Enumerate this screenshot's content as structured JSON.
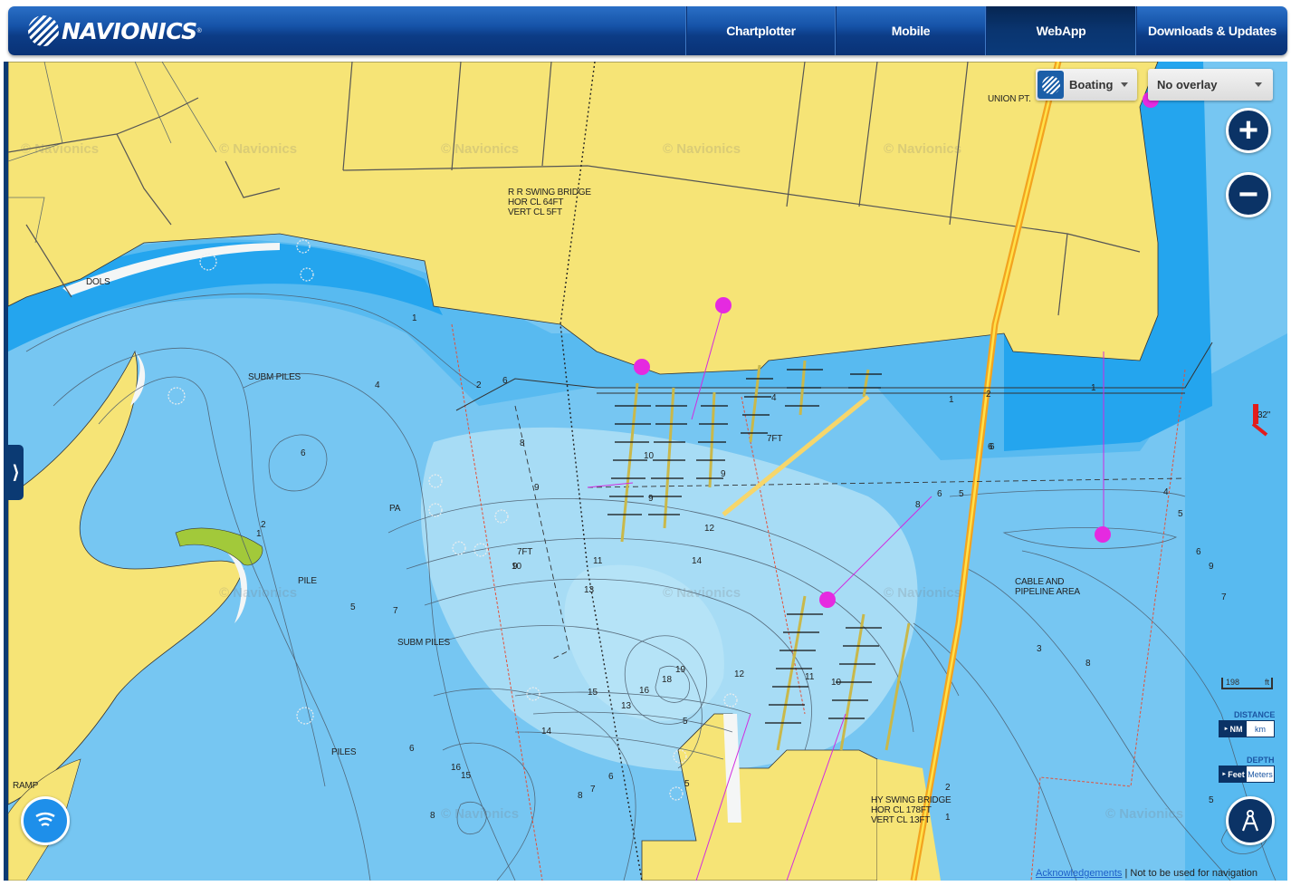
{
  "header": {
    "logo_text": "NAVIONICS",
    "logo_reg": "®",
    "nav": [
      {
        "label": "Chartplotter",
        "active": false
      },
      {
        "label": "Mobile",
        "active": false
      },
      {
        "label": "WebApp",
        "active": true
      },
      {
        "label": "Downloads & Updates",
        "active": false
      }
    ]
  },
  "map": {
    "chart_mode": {
      "selected": "Boating",
      "icon": "navionics-boating-icon"
    },
    "overlay": {
      "selected": "No overlay"
    },
    "zoom_in_label": "+",
    "zoom_out_label": "−",
    "side_toggle": "⟩",
    "scale": {
      "value": "198",
      "unit": "ft"
    },
    "distance": {
      "title": "DISTANCE",
      "options": [
        "NM",
        "km"
      ],
      "selected": "NM",
      "marker": "►"
    },
    "depth_units": {
      "title": "DEPTH",
      "options": [
        "Feet",
        "Meters"
      ],
      "selected": "Feet",
      "marker": "►"
    },
    "watermark": "© Navionics",
    "labels": {
      "union_pt": "UNION PT.",
      "rr_bridge": "R R SWING BRIDGE\nHOR CL 64FT\nVERT CL 5FT",
      "hy_bridge": "HY SWING BRIDGE\nHOR CL 178FT\nVERT CL 13FT",
      "dols": "DOLS",
      "subm_piles_1": "SUBM PILES",
      "subm_piles_2": "SUBM PILES",
      "pile": "PILE",
      "piles": "PILES",
      "pa": "PA",
      "ramp": "RAMP",
      "cable_area": "CABLE AND\nPIPELINE AREA",
      "seven_ft_1": "7FT",
      "seven_ft_2": "7FT",
      "current_32": "32\""
    },
    "soundings": [
      "1",
      "2",
      "4",
      "6",
      "6",
      "1",
      "2",
      "4",
      "5",
      "8",
      "9",
      "10",
      "9",
      "9",
      "9",
      "12",
      "14",
      "13",
      "11",
      "10",
      "7",
      "5",
      "6",
      "7",
      "8",
      "16",
      "15",
      "14",
      "15",
      "16",
      "19",
      "18",
      "12",
      "13",
      "5",
      "6",
      "11",
      "10",
      "6",
      "8",
      "6",
      "5",
      "2",
      "1",
      "1",
      "3",
      "4",
      "5",
      "6",
      "7",
      "8",
      "9",
      "5",
      "2",
      "1",
      "6",
      "8"
    ]
  },
  "footer": {
    "ack_link": "Acknowledgements",
    "separator": " | ",
    "disclaimer": "Not to be used for navigation"
  }
}
